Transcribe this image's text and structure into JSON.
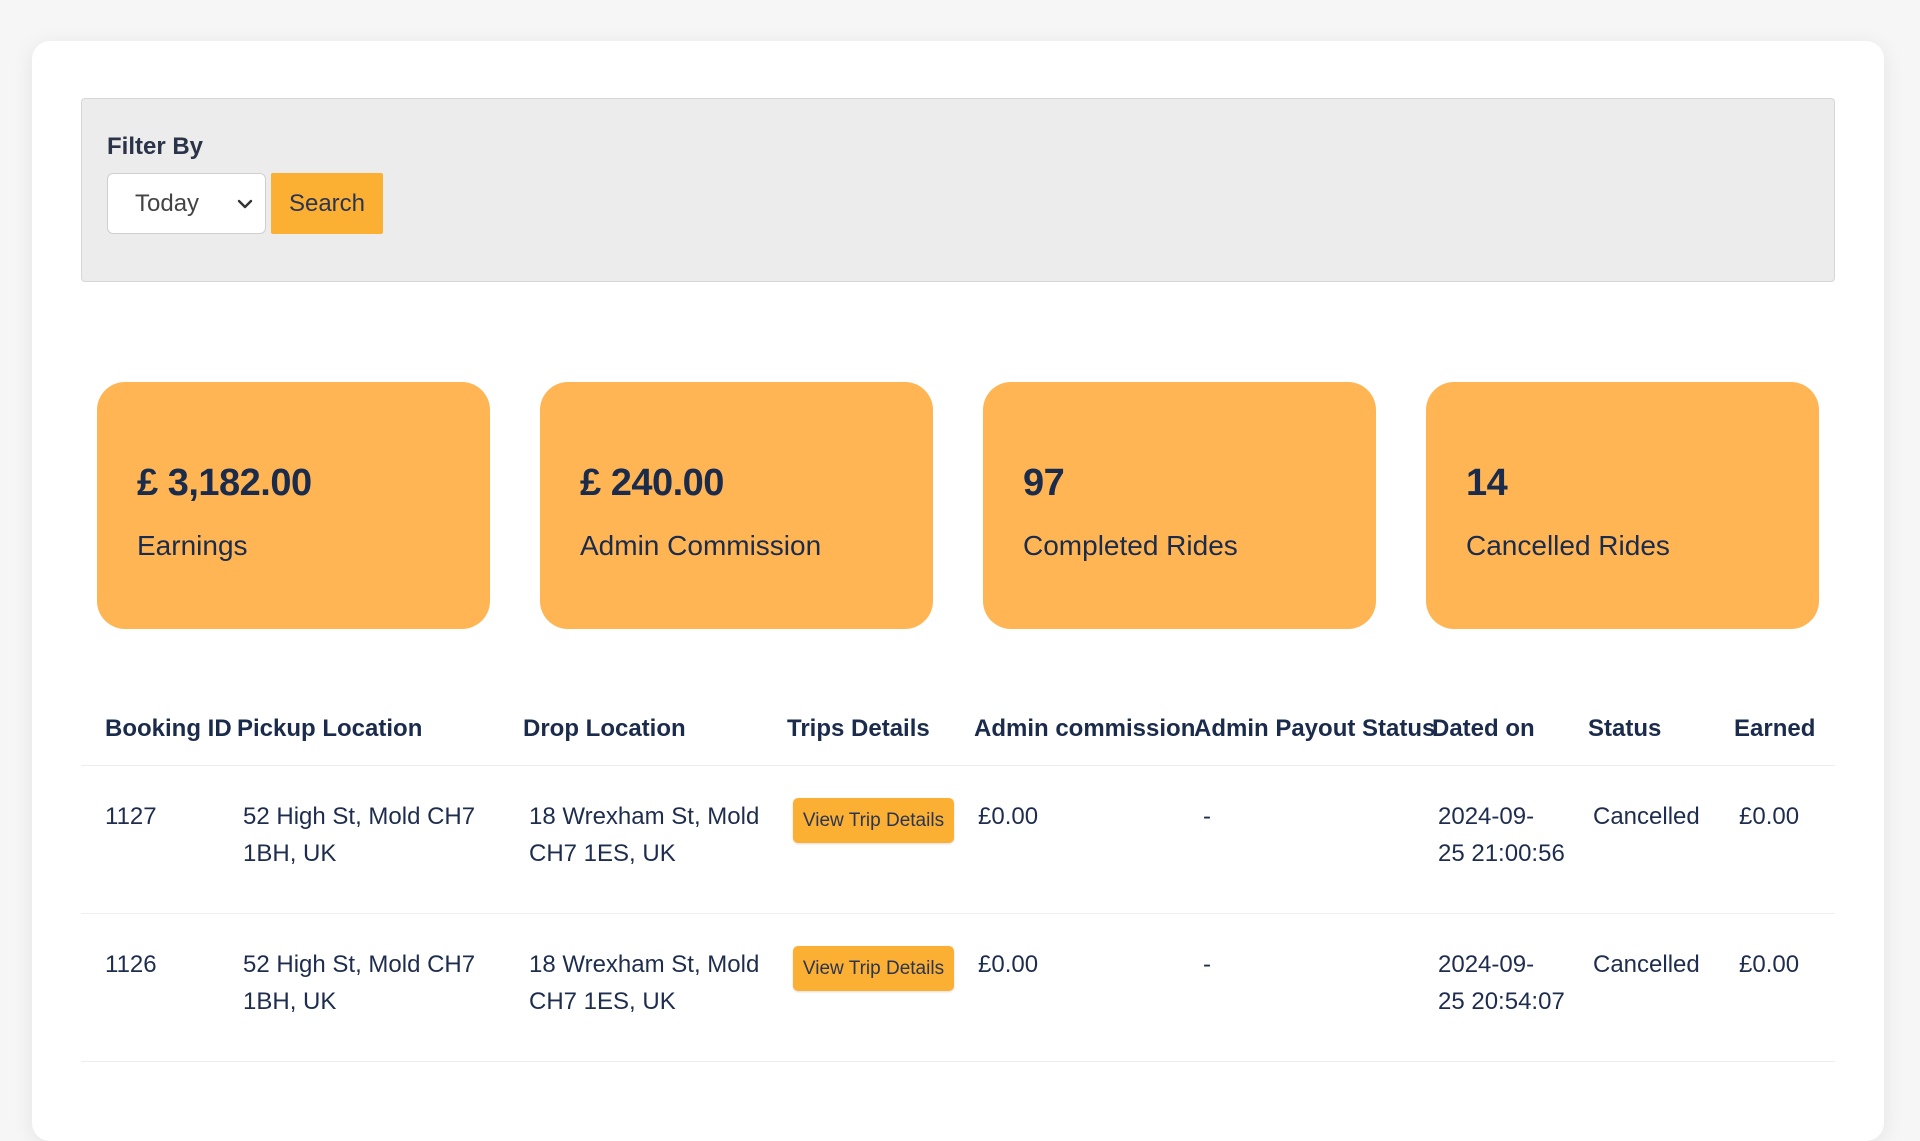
{
  "filter": {
    "label": "Filter By",
    "selected": "Today",
    "search_label": "Search"
  },
  "stats": [
    {
      "value": "£ 3,182.00",
      "label": "Earnings"
    },
    {
      "value": "£ 240.00",
      "label": "Admin Commission"
    },
    {
      "value": "97",
      "label": "Completed Rides"
    },
    {
      "value": "14",
      "label": "Cancelled Rides"
    }
  ],
  "table": {
    "headers": [
      "Booking ID",
      "Pickup Location",
      "Drop Location",
      "Trips Details",
      "Admin commission",
      "Admin Payout Status",
      "Dated on",
      "Status",
      "Earned"
    ],
    "rows": [
      {
        "booking_id": "1127",
        "pickup_line1": "52 High St, Mold CH7",
        "pickup_line2": "1BH, UK",
        "drop_line1": "18 Wrexham St, Mold",
        "drop_line2": "CH7 1ES, UK",
        "trip_button": "View Trip Details",
        "admin_commission": "£0.00",
        "payout_status": "-",
        "date_line1": "2024-09-",
        "date_line2": "25 21:00:56",
        "status": "Cancelled",
        "earned": "£0.00"
      },
      {
        "booking_id": "1126",
        "pickup_line1": "52 High St, Mold CH7",
        "pickup_line2": "1BH, UK",
        "drop_line1": "18 Wrexham St, Mold",
        "drop_line2": "CH7 1ES, UK",
        "trip_button": "View Trip Details",
        "admin_commission": "£0.00",
        "payout_status": "-",
        "date_line1": "2024-09-",
        "date_line2": "25 20:54:07",
        "status": "Cancelled",
        "earned": "£0.00"
      }
    ]
  },
  "colors": {
    "accent": "#fbb034",
    "card": "#ffb554",
    "text": "#1b2b4b"
  }
}
